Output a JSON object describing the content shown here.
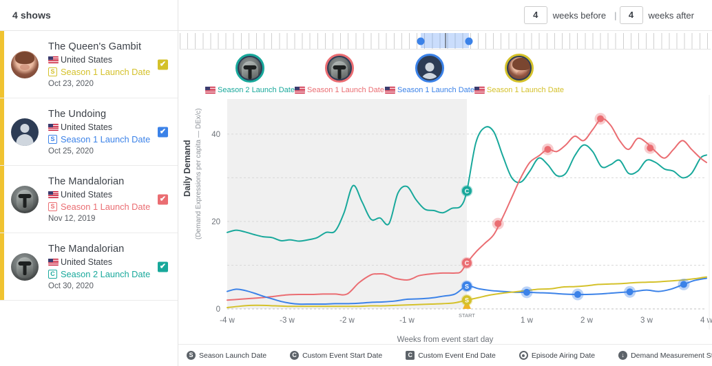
{
  "sidebar": {
    "header_title": "4 shows",
    "shows": [
      {
        "title": "The Queen's Gambit",
        "country": "United States",
        "event_badge": "S",
        "event_label": "Season 1 Launch Date",
        "date": "Oct 23, 2020",
        "color": "#d4c12a",
        "avatar_type": "face",
        "checked": true
      },
      {
        "title": "The Undoing",
        "country": "United States",
        "event_badge": "S",
        "event_label": "Season 1 Launch Date",
        "date": "Oct 25, 2020",
        "color": "#3b82e8",
        "avatar_type": "person",
        "checked": true
      },
      {
        "title": "The Mandalorian",
        "country": "United States",
        "event_badge": "S",
        "event_label": "Season 1 Launch Date",
        "date": "Nov 12, 2019",
        "color": "#ea6d72",
        "avatar_type": "mando",
        "checked": true
      },
      {
        "title": "The Mandalorian",
        "country": "United States",
        "event_badge": "C",
        "event_label": "Season 2 Launch Date",
        "date": "Oct 30, 2020",
        "color": "#18a89b",
        "avatar_type": "mando",
        "checked": true
      }
    ]
  },
  "header": {
    "weeks_before_value": "4",
    "weeks_before_label": "weeks before",
    "separator": "|",
    "weeks_after_value": "4",
    "weeks_after_label": "weeks after"
  },
  "event_avatars": [
    {
      "caption": "Season 2 Launch Date",
      "color": "#18a89b",
      "avatar_type": "mando",
      "x": 363
    },
    {
      "caption": "Season 1 Launch Date",
      "color": "#ea6d72",
      "avatar_type": "mando",
      "x": 493
    },
    {
      "caption": "Season 1 Launch Date",
      "color": "#3b82e8",
      "avatar_type": "person",
      "x": 624
    },
    {
      "caption": "Season 1 Launch Date",
      "color": "#d4c12a",
      "avatar_type": "face",
      "x": 754
    }
  ],
  "legend": [
    {
      "icon": "S",
      "shape": "circle",
      "label": "Season Launch Date"
    },
    {
      "icon": "C",
      "shape": "circle",
      "label": "Custom Event Start Date"
    },
    {
      "icon": "C",
      "shape": "square",
      "label": "Custom Event End Date"
    },
    {
      "icon": "",
      "shape": "ring",
      "label": "Episode Airing Date"
    },
    {
      "icon": "↓",
      "shape": "arrow",
      "label": "Demand Measurement Started"
    }
  ],
  "chart_data": {
    "type": "line",
    "title": "",
    "ylabel": "Daily Demand",
    "ylabel_sub": "(Demand Expressions per capita — DEx/c)",
    "xlabel": "Weeks from event start day",
    "xticks": [
      "-4 w",
      "-3 w",
      "-2 w",
      "-1 w",
      "START",
      "1 w",
      "2 w",
      "3 w",
      "4 w"
    ],
    "yticks": [
      0,
      20,
      40
    ],
    "ylim": [
      0,
      48
    ],
    "xlim": [
      -4,
      4
    ],
    "grid": true,
    "shaded_region": {
      "from": "-4 w",
      "to": "START",
      "color": "#f0f0f0"
    },
    "start_marker": {
      "label": "START",
      "color": "#f0b429"
    },
    "series": [
      {
        "name": "The Mandalorian — Season 2 Launch Date",
        "color": "#18a89b",
        "marker_letter": "C",
        "x": [
          -4.0,
          -3.85,
          -3.7,
          -3.55,
          -3.4,
          -3.25,
          -3.1,
          -2.95,
          -2.8,
          -2.65,
          -2.5,
          -2.35,
          -2.2,
          -2.05,
          -1.9,
          -1.75,
          -1.6,
          -1.45,
          -1.3,
          -1.15,
          -1.0,
          -0.85,
          -0.7,
          -0.55,
          -0.4,
          -0.25,
          -0.1,
          0.0,
          0.15,
          0.3,
          0.45,
          0.6,
          0.75,
          0.9,
          1.05,
          1.2,
          1.35,
          1.5,
          1.65,
          1.8,
          1.95,
          2.1,
          2.25,
          2.4,
          2.55,
          2.7,
          2.85,
          3.0,
          3.15,
          3.3,
          3.45,
          3.6,
          3.75,
          3.9,
          4.0
        ],
        "y": [
          17.5,
          18.0,
          17.6,
          17.0,
          16.5,
          16.3,
          15.6,
          15.8,
          15.5,
          15.8,
          16.3,
          17.5,
          17.8,
          22.0,
          28.2,
          24.5,
          20.5,
          20.8,
          19.5,
          26.5,
          28.0,
          25.0,
          22.8,
          22.5,
          22.0,
          23.0,
          23.5,
          27.0,
          38.0,
          41.5,
          40.5,
          35.0,
          30.0,
          29.0,
          31.5,
          34.5,
          33.0,
          30.5,
          31.0,
          35.0,
          37.5,
          36.0,
          32.5,
          33.0,
          34.0,
          31.0,
          31.5,
          34.0,
          33.5,
          32.0,
          31.5,
          30.0,
          31.0,
          34.5,
          35.2
        ]
      },
      {
        "name": "The Mandalorian — Season 1 Launch Date",
        "color": "#ea6d72",
        "marker_letter": "C",
        "x": [
          -4.0,
          -3.8,
          -3.6,
          -3.4,
          -3.2,
          -3.0,
          -2.8,
          -2.6,
          -2.4,
          -2.2,
          -2.0,
          -1.8,
          -1.6,
          -1.5,
          -1.4,
          -1.3,
          -1.2,
          -1.0,
          -0.9,
          -0.8,
          -0.6,
          -0.4,
          -0.2,
          -0.1,
          0.0,
          0.15,
          0.3,
          0.45,
          0.6,
          0.75,
          0.9,
          1.05,
          1.2,
          1.35,
          1.5,
          1.65,
          1.8,
          1.95,
          2.1,
          2.25,
          2.4,
          2.55,
          2.7,
          2.85,
          3.0,
          3.15,
          3.3,
          3.45,
          3.6,
          3.75,
          3.9,
          4.0
        ],
        "y": [
          2.0,
          2.2,
          2.4,
          2.6,
          2.9,
          3.2,
          3.3,
          3.3,
          3.4,
          3.4,
          3.4,
          6.0,
          7.8,
          8.0,
          8.0,
          7.6,
          7.0,
          6.6,
          7.0,
          7.6,
          8.0,
          8.2,
          8.2,
          8.5,
          10.5,
          13.0,
          15.0,
          17.0,
          21.0,
          25.5,
          30.0,
          33.5,
          35.0,
          36.5,
          36.0,
          37.5,
          39.5,
          38.5,
          41.0,
          43.5,
          42.0,
          38.5,
          36.5,
          39.0,
          38.0,
          36.0,
          34.5,
          36.5,
          38.5,
          36.5,
          34.5,
          33.5
        ]
      },
      {
        "name": "The Undoing — Season 1 Launch Date",
        "color": "#3b82e8",
        "marker_letter": "S",
        "x": [
          -4.0,
          -3.85,
          -3.7,
          -3.55,
          -3.4,
          -3.25,
          -3.1,
          -2.95,
          -2.8,
          -2.6,
          -2.4,
          -2.2,
          -2.0,
          -1.8,
          -1.6,
          -1.4,
          -1.2,
          -1.0,
          -0.8,
          -0.6,
          -0.4,
          -0.2,
          0.0,
          0.2,
          0.4,
          0.6,
          0.8,
          1.0,
          1.2,
          1.4,
          1.6,
          1.8,
          2.0,
          2.2,
          2.4,
          2.6,
          2.8,
          3.0,
          3.2,
          3.4,
          3.6,
          3.8,
          4.0
        ],
        "y": [
          4.0,
          4.5,
          4.2,
          3.6,
          2.9,
          2.3,
          1.7,
          1.3,
          1.1,
          1.1,
          1.1,
          1.2,
          1.2,
          1.3,
          1.5,
          1.6,
          1.8,
          2.2,
          2.3,
          2.5,
          2.9,
          3.4,
          5.2,
          4.6,
          4.2,
          4.0,
          3.8,
          3.8,
          3.7,
          3.6,
          3.4,
          3.3,
          3.3,
          3.4,
          3.6,
          3.8,
          4.0,
          4.3,
          4.0,
          4.5,
          5.5,
          6.5,
          7.0
        ]
      },
      {
        "name": "The Queen's Gambit — Season 1 Launch Date",
        "color": "#d4c12a",
        "marker_letter": "S",
        "x": [
          -4.0,
          -3.8,
          -3.6,
          -3.4,
          -3.2,
          -3.0,
          -2.8,
          -2.6,
          -2.4,
          -2.2,
          -2.0,
          -1.8,
          -1.6,
          -1.4,
          -1.2,
          -1.0,
          -0.8,
          -0.6,
          -0.4,
          -0.2,
          0.0,
          0.2,
          0.4,
          0.6,
          0.8,
          1.0,
          1.2,
          1.4,
          1.6,
          1.8,
          2.0,
          2.2,
          2.4,
          2.6,
          2.8,
          3.0,
          3.2,
          3.4,
          3.6,
          3.8,
          4.0
        ],
        "y": [
          0.3,
          0.6,
          0.8,
          0.8,
          0.7,
          0.6,
          0.6,
          0.6,
          0.6,
          0.6,
          0.6,
          0.6,
          0.7,
          0.7,
          0.8,
          0.9,
          1.0,
          1.1,
          1.2,
          1.4,
          2.0,
          2.6,
          3.2,
          3.6,
          3.9,
          4.2,
          4.5,
          4.6,
          5.0,
          5.1,
          5.3,
          5.6,
          5.7,
          5.8,
          6.0,
          6.1,
          6.2,
          6.4,
          6.6,
          6.9,
          7.3
        ]
      }
    ],
    "point_markers": [
      {
        "series": 0,
        "x": 0.0,
        "y": 27.0,
        "letter": "C",
        "color": "#18a89b",
        "kind": "letter"
      },
      {
        "series": 1,
        "x": 0.0,
        "y": 10.5,
        "letter": "C",
        "color": "#ea6d72",
        "kind": "letter"
      },
      {
        "series": 2,
        "x": 0.0,
        "y": 5.2,
        "letter": "S",
        "color": "#3b82e8",
        "kind": "letter"
      },
      {
        "series": 3,
        "x": 0.0,
        "y": 2.0,
        "letter": "S",
        "color": "#d4c12a",
        "kind": "letter"
      },
      {
        "series": 1,
        "x": 0.52,
        "y": 19.5,
        "letter": "",
        "color": "#ea6d72",
        "kind": "dot"
      },
      {
        "series": 1,
        "x": 1.35,
        "y": 36.5,
        "letter": "",
        "color": "#ea6d72",
        "kind": "dot"
      },
      {
        "series": 1,
        "x": 2.23,
        "y": 43.5,
        "letter": "",
        "color": "#ea6d72",
        "kind": "dot"
      },
      {
        "series": 1,
        "x": 3.06,
        "y": 36.8,
        "letter": "",
        "color": "#ea6d72",
        "kind": "dot"
      },
      {
        "series": 2,
        "x": 1.0,
        "y": 3.8,
        "letter": "",
        "color": "#3b82e8",
        "kind": "dot"
      },
      {
        "series": 2,
        "x": 1.85,
        "y": 3.3,
        "letter": "",
        "color": "#3b82e8",
        "kind": "dot"
      },
      {
        "series": 2,
        "x": 2.72,
        "y": 3.9,
        "letter": "",
        "color": "#3b82e8",
        "kind": "dot"
      },
      {
        "series": 2,
        "x": 3.62,
        "y": 5.6,
        "letter": "",
        "color": "#3b82e8",
        "kind": "dot"
      }
    ]
  }
}
